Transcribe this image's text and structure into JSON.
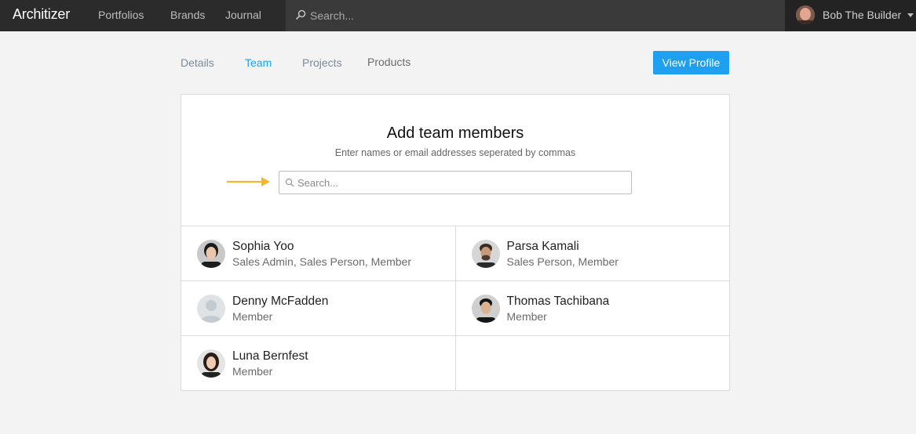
{
  "topbar": {
    "logo": "Architizer",
    "nav": [
      "Portfolios",
      "Brands",
      "Journal"
    ],
    "search_placeholder": "Search...",
    "user_name": "Bob The Builder"
  },
  "tabs": {
    "details": "Details",
    "team": "Team",
    "projects": "Projects",
    "products": "Products",
    "view_profile": "View Profile"
  },
  "card": {
    "title": "Add team members",
    "subtitle": "Enter names or email addresses seperated by commas",
    "search_placeholder": "Search..."
  },
  "members": [
    {
      "name": "Sophia Yoo",
      "role": "Sales Admin, Sales Person, Member"
    },
    {
      "name": "Parsa Kamali",
      "role": "Sales Person, Member"
    },
    {
      "name": "Denny McFadden",
      "role": "Member"
    },
    {
      "name": "Thomas Tachibana",
      "role": "Member"
    },
    {
      "name": "Luna Bernfest",
      "role": "Member"
    }
  ],
  "colors": {
    "accent": "#1f9ff0",
    "topbar": "#2b2b2b",
    "arrow": "#f4b731"
  }
}
